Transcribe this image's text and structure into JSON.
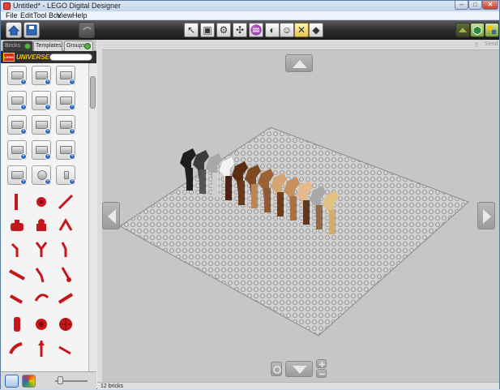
{
  "window": {
    "title": "Untitled* - LEGO Digital Designer",
    "min": "–",
    "max": "□",
    "close": "✕"
  },
  "menu": [
    "File",
    "Edit",
    "Tool Box",
    "View",
    "Help"
  ],
  "toolbar": {
    "left_buttons": [
      "home-icon",
      "save-icon",
      "undo-icon"
    ],
    "tools": [
      {
        "name": "select-tool",
        "glyph": "↖"
      },
      {
        "name": "clone-tool",
        "glyph": "▣"
      },
      {
        "name": "hinge-tool",
        "glyph": "⚙"
      },
      {
        "name": "hinge-align-tool",
        "glyph": "✣"
      },
      {
        "name": "flex-tool",
        "glyph": "♒"
      },
      {
        "name": "paint-bucket-tool",
        "glyph": "◐"
      },
      {
        "name": "decoration-tool",
        "glyph": "☺"
      },
      {
        "name": "delete-tool",
        "glyph": "✕"
      },
      {
        "name": "hide-tool",
        "glyph": "◆"
      }
    ],
    "right_modes": [
      "build-mode-icon",
      "view-mode-icon",
      "building-guide-mode-icon"
    ]
  },
  "left_panel": {
    "tabs": [
      "Bricks",
      "Templates",
      "Groups"
    ],
    "palette_name": "UNIVERSE",
    "logo_text": "LEGO",
    "search_placeholder": ""
  },
  "viewport": {
    "send_label": "Send"
  },
  "status": {
    "brick_count": "12 bricks"
  },
  "colors": {
    "toolbar_dark": "#2c2c2c",
    "accent_blue": "#2f66b5",
    "brick_red": "#c4161b",
    "baseplate": "#d2d2d2"
  },
  "scene": {
    "horse_colors": [
      "#1e1e1e",
      "#5a5a5a",
      "#f2f2f2",
      "#5b2d12",
      "#7d4a23",
      "#9a6235",
      "#b98656",
      "#8e5a36",
      "#d3a673",
      "#c88f5c",
      "#a8a8a8",
      "#e0c383"
    ]
  }
}
